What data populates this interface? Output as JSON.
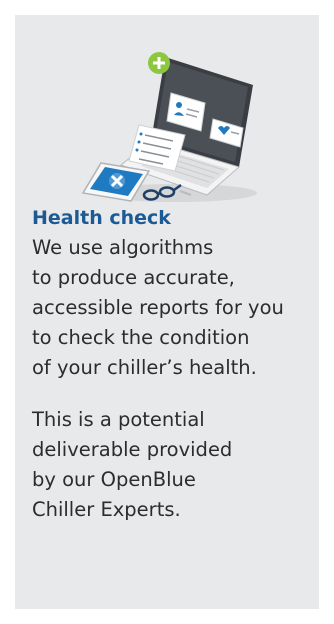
{
  "card": {
    "title": "Health check",
    "paragraphs": [
      {
        "lines": [
          "We use algorithms",
          "to produce accurate,",
          "accessible reports for you",
          "to check the condition",
          "of your chiller’s health."
        ]
      },
      {
        "lines": [
          "This is a potential",
          "deliverable provided",
          "by our OpenBlue",
          "Chiller Experts."
        ]
      }
    ]
  },
  "illustration": {
    "icons": [
      "laptop-icon",
      "plus-badge-icon",
      "user-card-icon",
      "heart-card-icon",
      "checklist-icon",
      "phone-icon",
      "glasses-icon"
    ],
    "colors": {
      "accent_green": "#8dc63f",
      "accent_blue": "#1f7bc1",
      "screen": "#3a3d43"
    }
  },
  "theme": {
    "background": "#e8e9eb",
    "title_color": "#1c5a95",
    "body_color": "#2c2c2c"
  }
}
